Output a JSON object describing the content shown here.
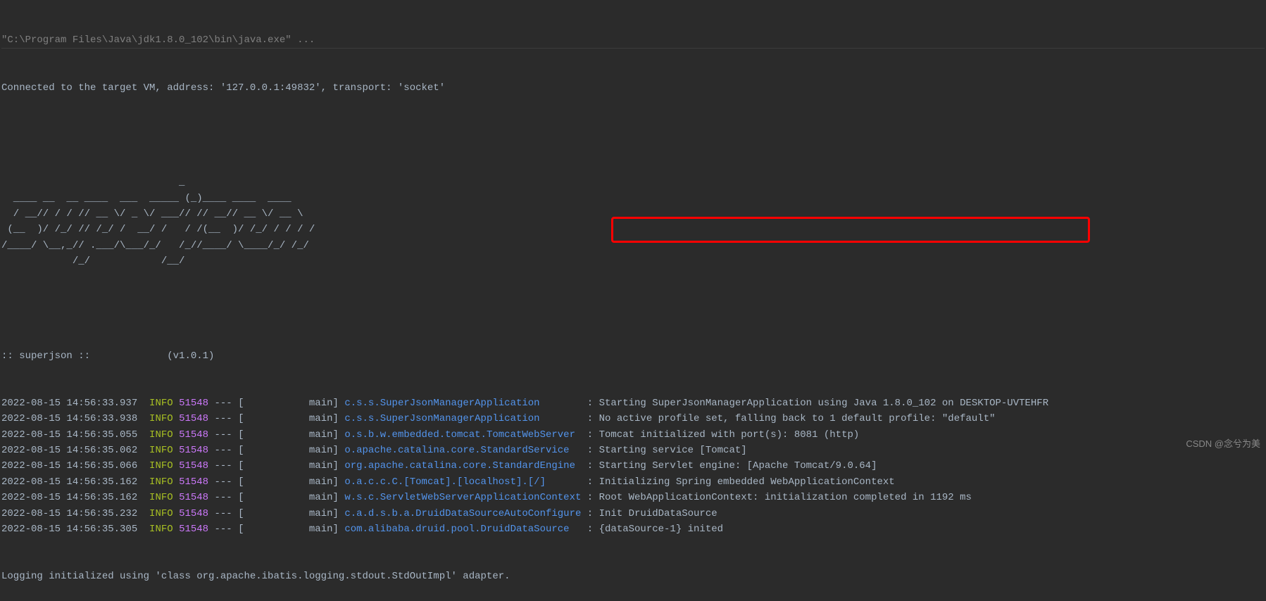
{
  "header": "\"C:\\Program Files\\Java\\jdk1.8.0_102\\bin\\java.exe\" ...",
  "vm_line": "Connected to the target VM, address: '127.0.0.1:49832', transport: 'socket'",
  "banner_lines": [
    "                              _",
    "  ____ __  __ ____  ___  _____ (_)____ ____  ____",
    "  / __// / / // __ \\/ _ \\/ ___// // __// __ \\/ __ \\",
    " (__  )/ /_/ // /_/ /  __/ /   / /(__  )/ /_/ / / / /",
    "/____/ \\__,_// .___/\\___/_/   /_//____/ \\____/_/ /_/",
    "            /_/            /__/"
  ],
  "version_line": ":: superjson ::             (v1.0.1)",
  "log_lines": [
    {
      "timestamp": "2022-08-15 14:56:33.937",
      "level": "INFO",
      "pid": "51548",
      "thread": "main",
      "logger": "c.s.s.SuperJsonManagerApplication",
      "logger_padded": "c.s.s.SuperJsonManagerApplication       ",
      "message": "Starting SuperJsonManagerApplication using Java 1.8.0_102 on DESKTOP-UVTEHFR",
      "highlighted": false
    },
    {
      "timestamp": "2022-08-15 14:56:33.938",
      "level": "INFO",
      "pid": "51548",
      "thread": "main",
      "logger": "c.s.s.SuperJsonManagerApplication",
      "logger_padded": "c.s.s.SuperJsonManagerApplication       ",
      "message": "No active profile set, falling back to 1 default profile: \"default\"",
      "highlighted": true
    },
    {
      "timestamp": "2022-08-15 14:56:35.055",
      "level": "INFO",
      "pid": "51548",
      "thread": "main",
      "logger": "o.s.b.w.embedded.tomcat.TomcatWebServer",
      "logger_padded": "o.s.b.w.embedded.tomcat.TomcatWebServer ",
      "message": "Tomcat initialized with port(s): 8081 (http)",
      "highlighted": false
    },
    {
      "timestamp": "2022-08-15 14:56:35.062",
      "level": "INFO",
      "pid": "51548",
      "thread": "main",
      "logger": "o.apache.catalina.core.StandardService",
      "logger_padded": "o.apache.catalina.core.StandardService  ",
      "message": "Starting service [Tomcat]",
      "highlighted": false
    },
    {
      "timestamp": "2022-08-15 14:56:35.066",
      "level": "INFO",
      "pid": "51548",
      "thread": "main",
      "logger": "org.apache.catalina.core.StandardEngine",
      "logger_padded": "org.apache.catalina.core.StandardEngine ",
      "message": "Starting Servlet engine: [Apache Tomcat/9.0.64]",
      "highlighted": false
    },
    {
      "timestamp": "2022-08-15 14:56:35.162",
      "level": "INFO",
      "pid": "51548",
      "thread": "main",
      "logger": "o.a.c.c.C.[Tomcat].[localhost].[/]",
      "logger_padded": "o.a.c.c.C.[Tomcat].[localhost].[/]      ",
      "message": "Initializing Spring embedded WebApplicationContext",
      "highlighted": false
    },
    {
      "timestamp": "2022-08-15 14:56:35.162",
      "level": "INFO",
      "pid": "51548",
      "thread": "main",
      "logger": "w.s.c.ServletWebServerApplicationContext",
      "logger_padded": "w.s.c.ServletWebServerApplicationContext",
      "message": "Root WebApplicationContext: initialization completed in 1192 ms",
      "highlighted": false
    },
    {
      "timestamp": "2022-08-15 14:56:35.232",
      "level": "INFO",
      "pid": "51548",
      "thread": "main",
      "logger": "c.a.d.s.b.a.DruidDataSourceAutoConfigure",
      "logger_padded": "c.a.d.s.b.a.DruidDataSourceAutoConfigure",
      "message": "Init DruidDataSource",
      "highlighted": false
    },
    {
      "timestamp": "2022-08-15 14:56:35.305",
      "level": "INFO",
      "pid": "51548",
      "thread": "main",
      "logger": "com.alibaba.druid.pool.DruidDataSource",
      "logger_padded": "com.alibaba.druid.pool.DruidDataSource  ",
      "message": "{dataSource-1} inited",
      "highlighted": false
    }
  ],
  "footer": "Logging initialized using 'class org.apache.ibatis.logging.stdout.StdOutImpl' adapter.",
  "watermark": "CSDN @念兮为美"
}
